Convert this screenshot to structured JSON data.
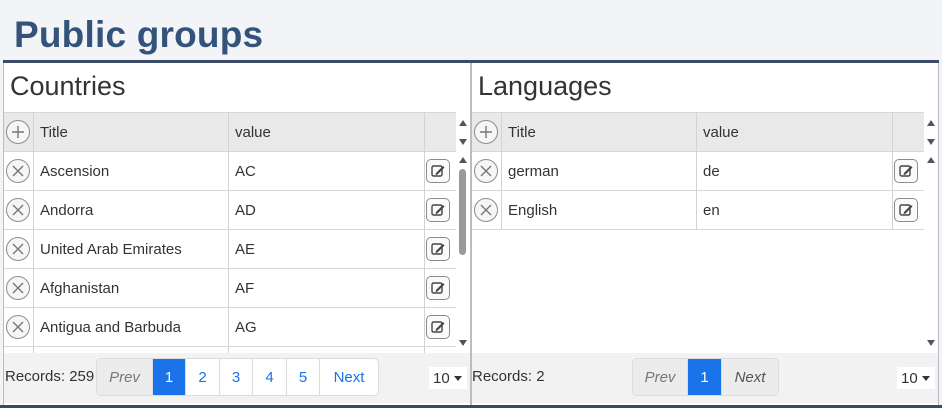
{
  "page": {
    "title": "Public groups"
  },
  "icons": {
    "add": "plus-icon",
    "delete": "x-icon",
    "edit": "pencil-square-icon",
    "scroll_up": "triangle-up-icon",
    "scroll_down": "triangle-down-icon"
  },
  "colors": {
    "title": "#34537a",
    "accent": "#1a73e8",
    "rule": "#3b4a66"
  },
  "countries": {
    "title": "Countries",
    "columns": [
      "Title",
      "value"
    ],
    "rows": [
      {
        "title": "Ascension",
        "value": "AC"
      },
      {
        "title": "Andorra",
        "value": "AD"
      },
      {
        "title": "United Arab Emirates",
        "value": "AE"
      },
      {
        "title": "Afghanistan",
        "value": "AF"
      },
      {
        "title": "Antigua and Barbuda",
        "value": "AG"
      }
    ],
    "records": "Records: 259",
    "pager": {
      "prev": "Prev",
      "pages": [
        "1",
        "2",
        "3",
        "4",
        "5"
      ],
      "next": "Next"
    },
    "page_size": "10"
  },
  "languages": {
    "title": "Languages",
    "columns": [
      "Title",
      "value"
    ],
    "rows": [
      {
        "title": "german",
        "value": "de"
      },
      {
        "title": "English",
        "value": "en"
      }
    ],
    "records": "Records: 2",
    "pager": {
      "prev": "Prev",
      "pages": [
        "1"
      ],
      "next": "Next"
    },
    "page_size": "10"
  }
}
